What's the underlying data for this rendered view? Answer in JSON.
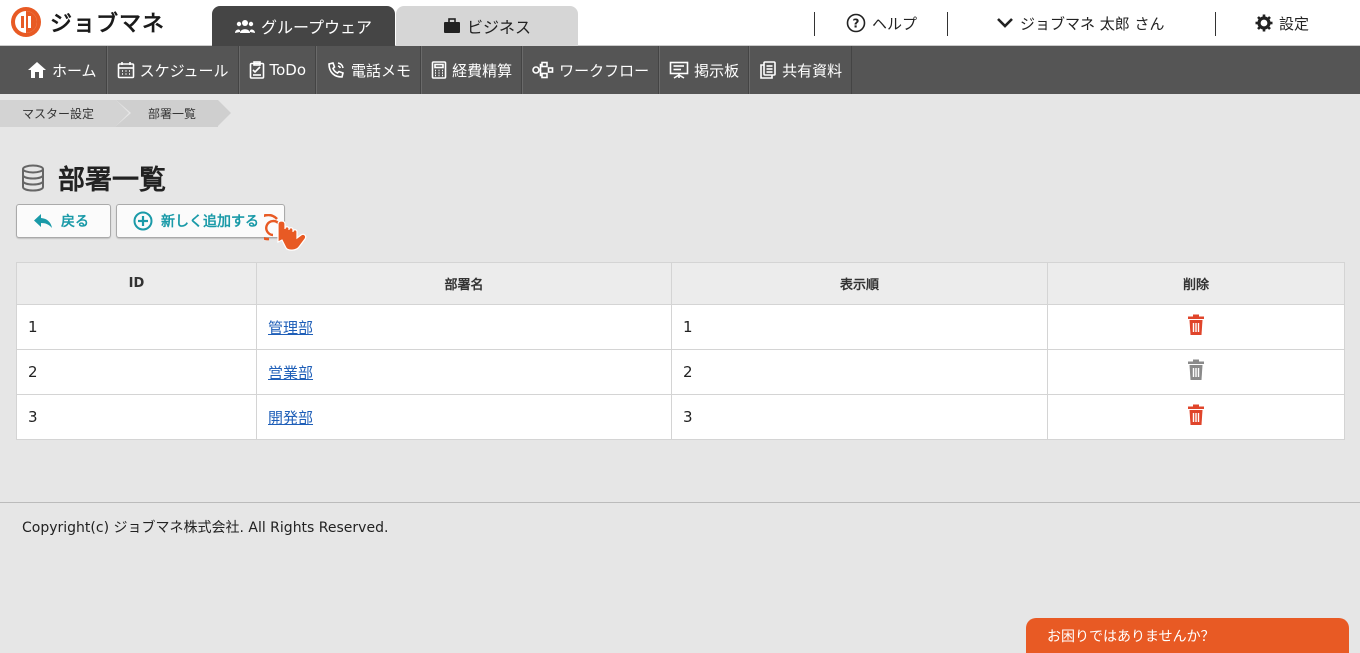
{
  "app": {
    "logo_text": "ジョブマネ"
  },
  "tabs": {
    "groupware": "グループウェア",
    "business": "ビジネス"
  },
  "header_links": {
    "help": "ヘルプ",
    "user": "ジョブマネ 太郎 さん",
    "settings": "設定"
  },
  "nav": {
    "items": [
      {
        "label": "ホーム",
        "icon": "home-icon"
      },
      {
        "label": "スケジュール",
        "icon": "calendar-icon"
      },
      {
        "label": "ToDo",
        "icon": "todo-icon"
      },
      {
        "label": "電話メモ",
        "icon": "phone-icon"
      },
      {
        "label": "経費精算",
        "icon": "calculator-icon"
      },
      {
        "label": "ワークフロー",
        "icon": "workflow-icon"
      },
      {
        "label": "掲示板",
        "icon": "board-icon"
      },
      {
        "label": "共有資料",
        "icon": "documents-icon"
      }
    ]
  },
  "breadcrumb": {
    "parent": "マスター設定",
    "current": "部署一覧"
  },
  "page": {
    "title": "部署一覧"
  },
  "buttons": {
    "back": "戻る",
    "add": "新しく追加する"
  },
  "table": {
    "headers": {
      "id": "ID",
      "name": "部署名",
      "order": "表示順",
      "delete": "削除"
    },
    "rows": [
      {
        "id": "1",
        "name": "管理部",
        "order": "1",
        "delete_color": "#e0452b"
      },
      {
        "id": "2",
        "name": "営業部",
        "order": "2",
        "delete_color": "#8a8a8a"
      },
      {
        "id": "3",
        "name": "開発部",
        "order": "3",
        "delete_color": "#e0452b"
      }
    ]
  },
  "footer": {
    "copyright": "Copyright(c) ジョブマネ株式会社. All Rights Reserved.",
    "help_prompt": "お困りではありませんか？"
  },
  "colors": {
    "accent": "#1a9aa8",
    "brand_orange": "#e85a24",
    "nav_bg": "#555555",
    "link": "#1f5fb8"
  }
}
